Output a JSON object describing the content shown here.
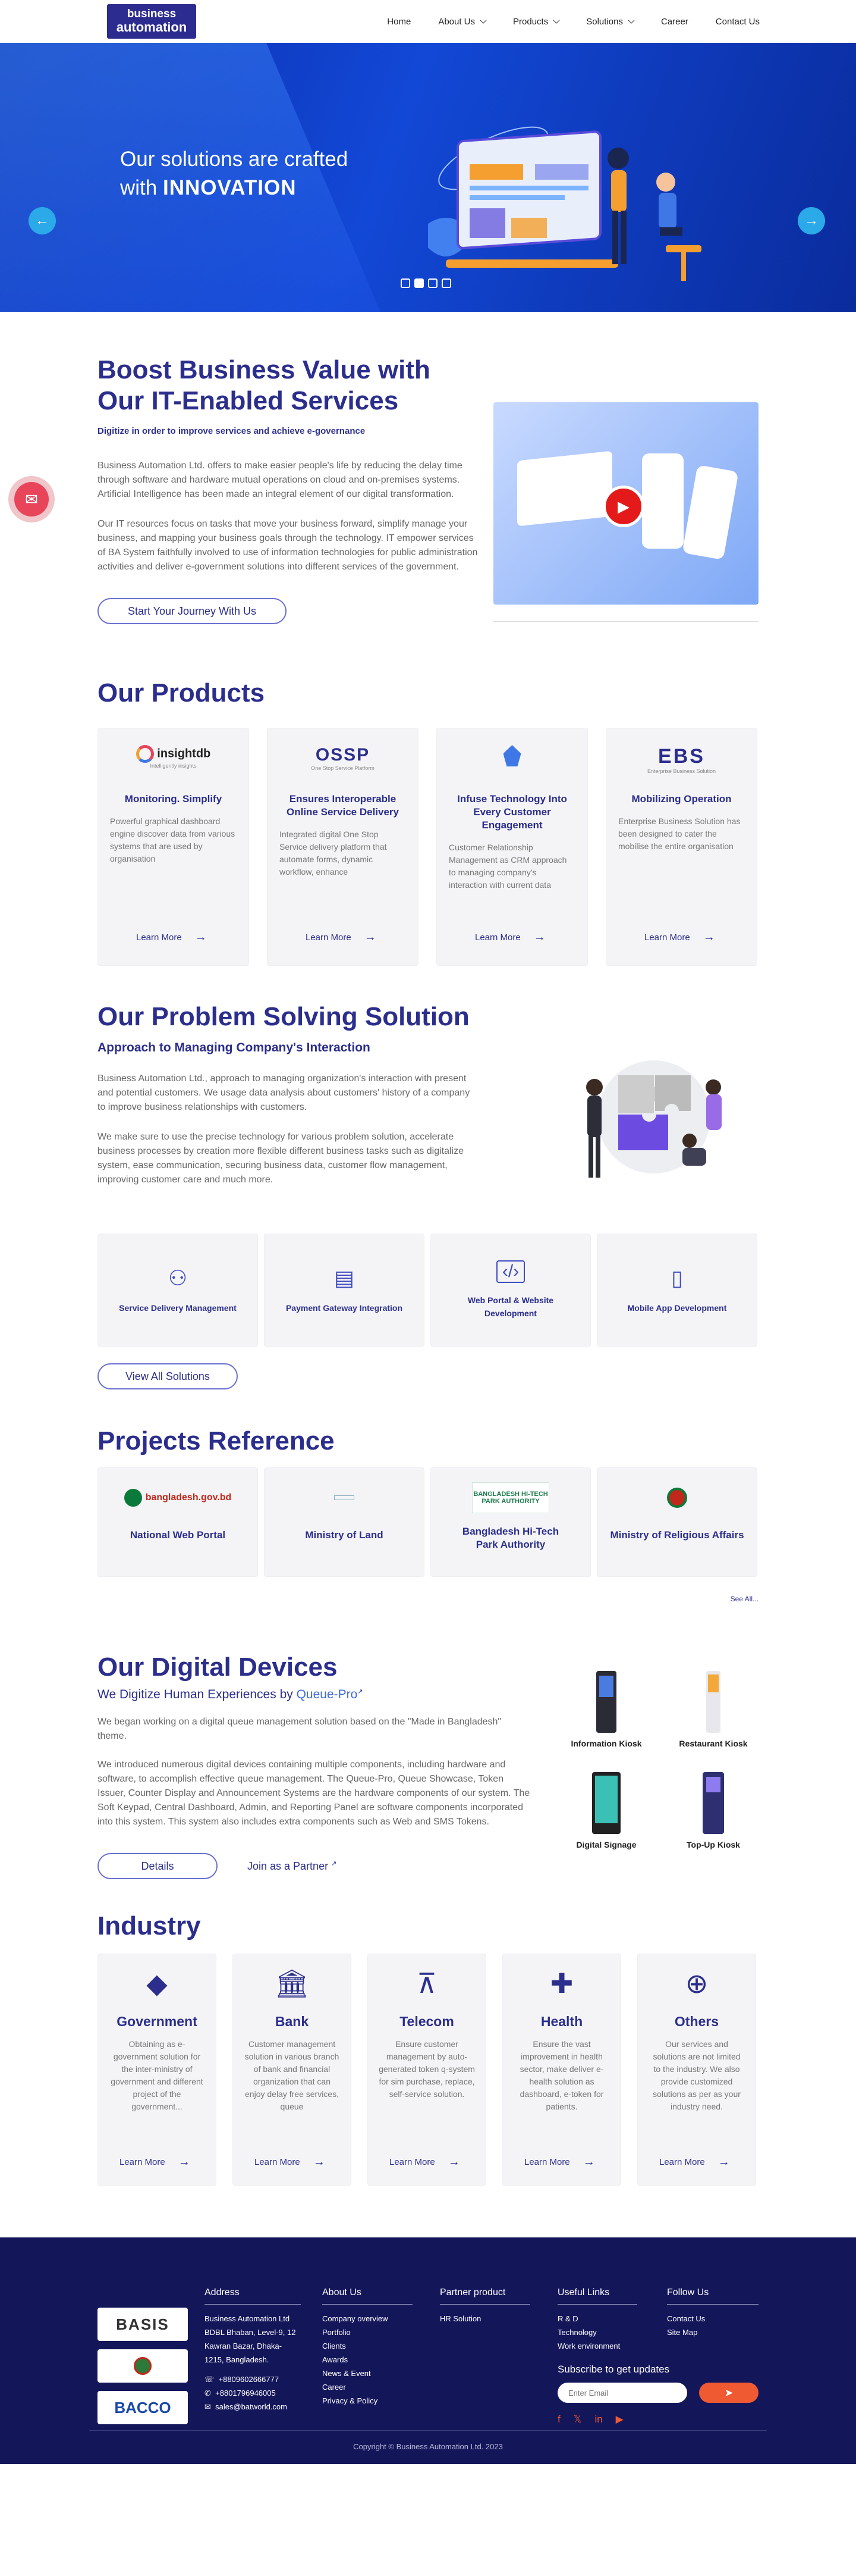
{
  "nav": {
    "logo_line1": "business",
    "logo_line2": "automation",
    "items": [
      "Home",
      "About Us",
      "Products",
      "Solutions",
      "Career",
      "Contact Us"
    ]
  },
  "hero": {
    "line1": "Our solutions are crafted",
    "line2_pre": "with ",
    "line2_bold": "INNOVATION",
    "prev": "←",
    "next": "→"
  },
  "boost": {
    "title": "Boost Business Value with Our IT-Enabled Services",
    "tagline": "Digitize in order to improve services and achieve e-governance",
    "p1": "Business Automation Ltd. offers to make easier people's life by reducing the delay time through software and hardware mutual operations on cloud and on-premises systems. Artificial Intelligence has been made an integral element of our digital transformation.",
    "p2": "Our IT resources focus on tasks that move your business forward, simplify manage your business, and mapping your business goals through the technology. IT empower services of BA System faithfully involved to use of information technologies for public administration activities and deliver e-government solutions into different services of the government.",
    "button": "Start Your Journey With Us"
  },
  "products": {
    "title": "Our Products",
    "learn": "Learn More",
    "items": [
      {
        "logo": "insightdb",
        "logo_sub": "Intelligently insights",
        "title": "Monitoring. Simplify",
        "desc": "Powerful graphical dashboard engine discover data from various systems that are used by organisation"
      },
      {
        "logo": "OSSP",
        "logo_sub": "One Stop Service Platform",
        "title": "Ensures Interoperable Online Service Delivery",
        "desc": "Integrated digital One Stop Service delivery platform that automate forms, dynamic workflow, enhance"
      },
      {
        "logo": "",
        "logo_sub": "",
        "title": "Infuse Technology Into Every Customer Engagement",
        "desc": "Customer Relationship Management as CRM approach to managing company's interaction with current data"
      },
      {
        "logo": "EBS",
        "logo_sub": "Enterprise Business Solution",
        "title": "Mobilizing Operation",
        "desc": "Enterprise Business Solution has been designed to cater the mobilise the entire organisation"
      }
    ]
  },
  "solution": {
    "title": "Our Problem Solving Solution",
    "subtitle": "Approach to Managing Company's Interaction",
    "p1": "Business Automation Ltd., approach to managing organization's interaction with present and potential customers. We usage data analysis about customers' history of a company to improve business relationships with customers.",
    "p2": "We make sure to use the precise technology for various problem solution, accelerate business processes by creation more flexible different business tasks such as digitalize system, ease communication, securing business data, customer flow management, improving customer care and much more.",
    "items": [
      "Service Delivery Management",
      "Payment Gateway Integration",
      "Web Portal & Website Development",
      "Mobile App Development"
    ],
    "button": "View All Solutions"
  },
  "projects": {
    "title": "Projects Reference",
    "items": [
      {
        "logo": "bangladesh.gov.bd",
        "name": "National Web Portal"
      },
      {
        "logo": "",
        "name": "Ministry of Land"
      },
      {
        "logo": "BANGLADESH HI-TECH PARK AUTHORITY",
        "name": "Bangladesh Hi-Tech Park Authority"
      },
      {
        "logo": "",
        "name": "Ministry of Religious Affairs"
      }
    ],
    "see_all": "See All..."
  },
  "devices": {
    "title": "Our Digital Devices",
    "subtitle_pre": "We Digitize Human Experiences by ",
    "subtitle_link": "Queue-Pro",
    "p1": "We began working on a digital queue management solution based on the \"Made in Bangladesh\" theme.",
    "p2": "We introduced numerous digital devices containing multiple components, including hardware and software, to accomplish effective queue management. The Queue-Pro, Queue Showcase, Token Issuer, Counter Display and Announcement Systems are the hardware components of our system. The Soft Keypad, Central Dashboard, Admin, and Reporting Panel are software components incorporated into this system. This system also includes extra components such as Web and SMS Tokens.",
    "details": "Details",
    "partner": "Join as a Partner",
    "items": [
      "Information Kiosk",
      "Restaurant Kiosk",
      "Digital Signage",
      "Top-Up Kiosk"
    ]
  },
  "industry": {
    "title": "Industry",
    "learn": "Learn More",
    "items": [
      {
        "name": "Government",
        "icon": "bangladesh-map-icon",
        "desc": "Obtaining as e-government solution for the inter-ministry of government and different project of the government..."
      },
      {
        "name": "Bank",
        "icon": "bank-icon",
        "desc": "Customer management solution in various branch of bank and financial organization that can enjoy delay free services, queue"
      },
      {
        "name": "Telecom",
        "icon": "tower-icon",
        "desc": "Ensure customer management by auto-generated token q-system for sim purchase, replace, self-service solution."
      },
      {
        "name": "Health",
        "icon": "health-icon",
        "desc": "Ensure the vast improvement in health sector, make deliver e-health solution as dashboard, e-token for patients."
      },
      {
        "name": "Others",
        "icon": "globe-icon",
        "desc": "Our services and solutions are not limited to the industry. We also provide customized solutions as per as your industry need."
      }
    ]
  },
  "footer": {
    "partners": [
      "BASIS",
      "",
      "BACCO"
    ],
    "address_title": "Address",
    "address": [
      "Business Automation Ltd",
      "BDBL Bhaban, Level-9, 12",
      "Kawran Bazar, Dhaka-",
      "1215, Bangladesh."
    ],
    "phone1": "+8809602666777",
    "phone2": "+8801796946005",
    "email": "sales@batworld.com",
    "about_title": "About Us",
    "about": [
      "Company overview",
      "Portfolio",
      "Clients",
      "Awards",
      "News & Event",
      "Career",
      "Privacy & Policy"
    ],
    "partner_title": "Partner product",
    "partner_items": [
      "HR Solution"
    ],
    "links_title": "Useful Links",
    "links": [
      "R & D",
      "Technology",
      "Work environment"
    ],
    "follow_title": "Follow Us",
    "follow": [
      "Contact Us",
      "Site Map"
    ],
    "subscribe_title": "Subscribe to get updates",
    "email_placeholder": "Enter Email",
    "copyright": "Copyright © Business Automation Ltd. 2023"
  },
  "colors": {
    "brand": "#2b2e8c",
    "hero": "#1248d6",
    "footer": "#14165a",
    "subscribe": "#ef5a32"
  }
}
